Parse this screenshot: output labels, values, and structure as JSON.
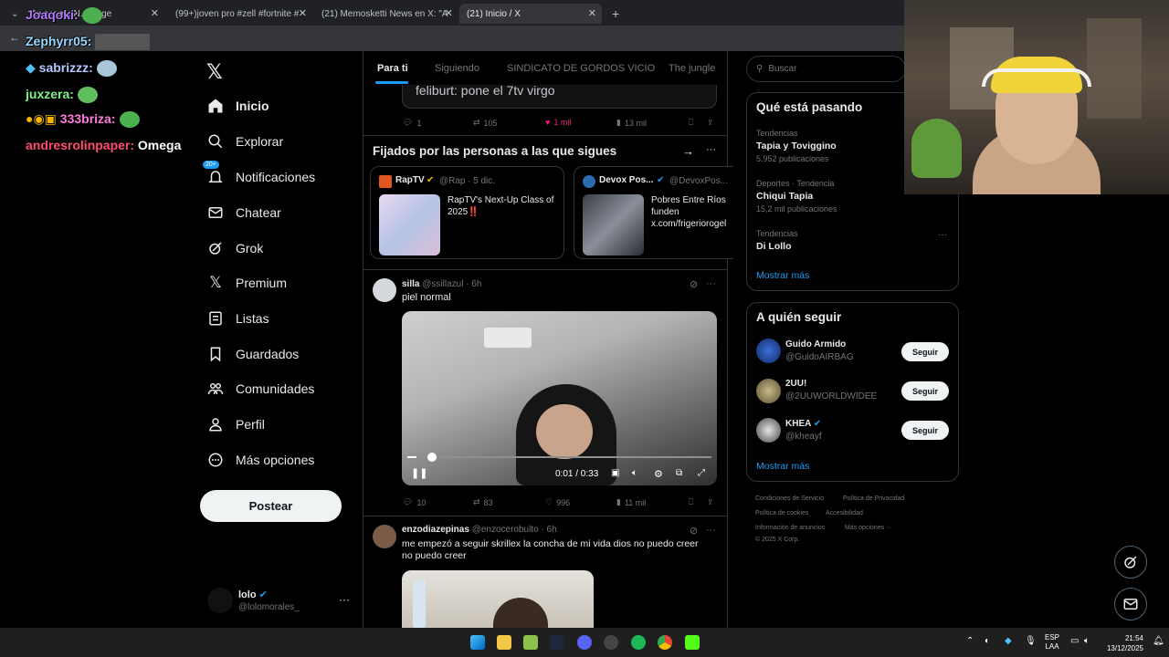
{
  "browser": {
    "tabs": [
      {
        "label": "Awesome N... Page"
      },
      {
        "label": "(99+)joven pro #zell #fortnite #"
      },
      {
        "label": "(21) Memosketti News en X: \"A"
      },
      {
        "label": "(21) Inicio / X"
      }
    ]
  },
  "overlay_chat": [
    {
      "user": "Joaqoki:",
      "msg": ""
    },
    {
      "user": "Zephyrr05:",
      "msg": ""
    },
    {
      "user": "sabrizzz:",
      "msg": ""
    },
    {
      "user": "juxzera:",
      "msg": ""
    },
    {
      "user": "333briza:",
      "msg": ""
    },
    {
      "user": "andresrolinpaper:",
      "msg": "Omega"
    }
  ],
  "nav": {
    "items": [
      {
        "label": "Inicio",
        "icon": "home-icon"
      },
      {
        "label": "Explorar",
        "icon": "search-icon"
      },
      {
        "label": "Notificaciones",
        "icon": "bell-icon",
        "badge": "20+"
      },
      {
        "label": "Chatear",
        "icon": "mail-icon"
      },
      {
        "label": "Grok",
        "icon": "grok-icon"
      },
      {
        "label": "Premium",
        "icon": "x-logo-icon"
      },
      {
        "label": "Listas",
        "icon": "list-icon"
      },
      {
        "label": "Guardados",
        "icon": "bookmark-icon"
      },
      {
        "label": "Comunidades",
        "icon": "communities-icon"
      },
      {
        "label": "Perfil",
        "icon": "person-icon"
      },
      {
        "label": "Más opciones",
        "icon": "more-circle-icon"
      }
    ],
    "post_label": "Postear",
    "account": {
      "name": "lolo",
      "handle": "@lolomorales_"
    }
  },
  "timeline": {
    "tabs": [
      "Para ti",
      "Siguiendo",
      "SINDICATO DE GORDOS VICIO",
      "The jungle"
    ],
    "prev_post": {
      "quote_text": "feliburt: pone el 7tv virgo",
      "replies": "1",
      "reposts": "105",
      "likes": "1 mil",
      "views": "13 mil"
    },
    "pinned": {
      "title": "Fijados por las personas a las que sigues",
      "cards": [
        {
          "name": "RapTV",
          "handle": "@Rap",
          "date": "· 5 dic.",
          "text": "RapTV's Next-Up Class of 2025‼️"
        },
        {
          "name": "Devox Pos...",
          "handle": "@DevoxPos...",
          "text": "Pobres Entre Ríos funden x.com/frigeriorogel"
        }
      ]
    },
    "post1": {
      "name": "silla",
      "handle": "@ssillazul",
      "time": "· 6h",
      "text": "piel normal",
      "video_time": "0:01 / 0:33",
      "video_progress": 0.03,
      "replies": "10",
      "reposts": "83",
      "likes": "996",
      "views": "11 mil"
    },
    "post2": {
      "name": "enzodiazepinas",
      "handle": "@enzocerobulto",
      "time": "· 6h",
      "text": "me empezó a seguir skrillex la concha de mi vida dios no puedo creer no puedo creer"
    }
  },
  "sidebar": {
    "search_placeholder": "Buscar",
    "trends": {
      "title": "Qué está pasando",
      "items": [
        {
          "context": "Tendencias",
          "name": "Tapia y Toviggino",
          "count": "5.952 publicaciones"
        },
        {
          "context": "Deportes · Tendencia",
          "name": "Chiqui Tapia",
          "count": "15,2 mil publicaciones"
        },
        {
          "context": "Tendencias",
          "name": "Di Lollo",
          "count": ""
        }
      ],
      "more": "Mostrar más"
    },
    "who_to_follow": {
      "title": "A quién seguir",
      "items": [
        {
          "name": "Guido Armido",
          "handle": "@GuidoAIRBAG",
          "btn": "Seguir"
        },
        {
          "name": "2UU!",
          "handle": "@2UUWORLDWIDEE",
          "btn": "Seguir"
        },
        {
          "name": "KHEA",
          "handle": "@kheayf",
          "btn": "Seguir"
        }
      ],
      "more": "Mostrar más"
    },
    "footer": {
      "links": [
        "Condiciones de Servicio",
        "Política de Privacidad",
        "Política de cookies",
        "Accesibilidad",
        "Información de anuncios",
        "Más opciones ···"
      ],
      "copyright": "© 2025 X Corp."
    }
  },
  "taskbar": {
    "lang": "ESP",
    "lang2": "LAA",
    "time": "21:54",
    "date": "13/12/2025"
  },
  "colors": {
    "accent": "#1d9bf0",
    "like": "#f91880",
    "bg": "#000000"
  }
}
